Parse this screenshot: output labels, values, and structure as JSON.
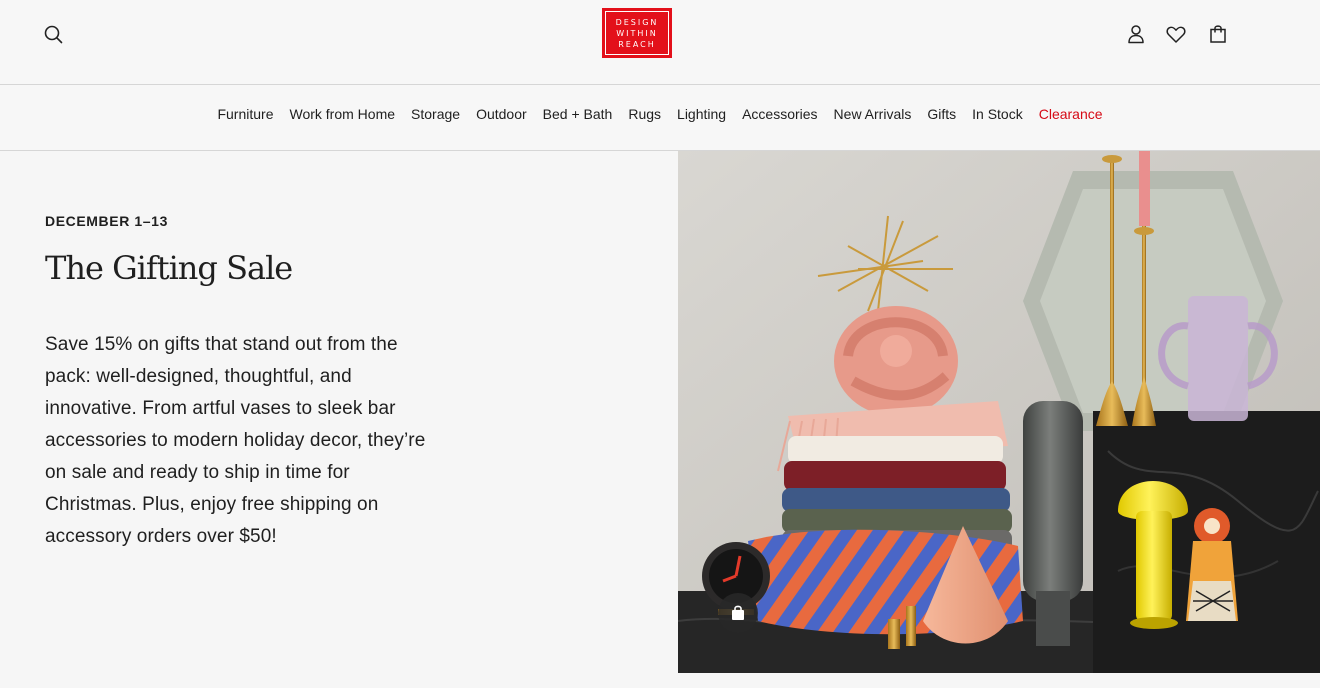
{
  "header": {
    "logo_lines": [
      "DESIGN",
      "WITHIN",
      "REACH"
    ],
    "icons": {
      "search": "search-icon",
      "account": "user-icon",
      "wishlist": "heart-icon",
      "cart": "shopping-bag-icon"
    }
  },
  "nav": {
    "items": [
      {
        "label": "Furniture"
      },
      {
        "label": "Work from Home"
      },
      {
        "label": "Storage"
      },
      {
        "label": "Outdoor"
      },
      {
        "label": "Bed + Bath"
      },
      {
        "label": "Rugs"
      },
      {
        "label": "Lighting"
      },
      {
        "label": "Accessories"
      },
      {
        "label": "New Arrivals"
      },
      {
        "label": "Gifts"
      },
      {
        "label": "In Stock"
      },
      {
        "label": "Clearance"
      }
    ],
    "sale_color": "#d60a16"
  },
  "hero": {
    "eyebrow": "DECEMBER 1–13",
    "title": "The Gifting Sale",
    "body": "Save 15% on gifts that stand out from the pack: well-designed, thoughtful, and innovative. From artful vases to sleek bar accessories to modern holiday decor, they’re on sale and ready to ship in time for Christmas. Plus, enjoy free shipping on accessory orders over $50!",
    "shop_icon": "shopping-bag-icon"
  },
  "colors": {
    "brand_red": "#e3101a",
    "background": "#f6f6f6"
  }
}
